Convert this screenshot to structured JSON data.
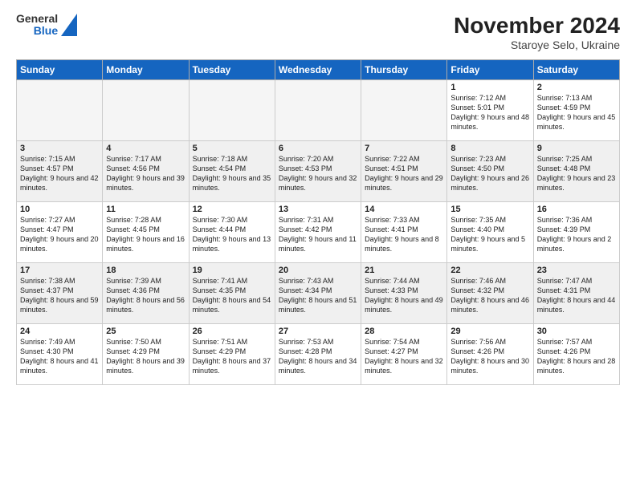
{
  "header": {
    "logo": {
      "general": "General",
      "blue": "Blue"
    },
    "title": "November 2024",
    "subtitle": "Staroye Selo, Ukraine"
  },
  "days_of_week": [
    "Sunday",
    "Monday",
    "Tuesday",
    "Wednesday",
    "Thursday",
    "Friday",
    "Saturday"
  ],
  "weeks": [
    [
      {
        "day": "",
        "empty": true
      },
      {
        "day": "",
        "empty": true
      },
      {
        "day": "",
        "empty": true
      },
      {
        "day": "",
        "empty": true
      },
      {
        "day": "",
        "empty": true
      },
      {
        "day": "1",
        "sunrise": "Sunrise: 7:12 AM",
        "sunset": "Sunset: 5:01 PM",
        "daylight": "Daylight: 9 hours and 48 minutes."
      },
      {
        "day": "2",
        "sunrise": "Sunrise: 7:13 AM",
        "sunset": "Sunset: 4:59 PM",
        "daylight": "Daylight: 9 hours and 45 minutes."
      }
    ],
    [
      {
        "day": "3",
        "sunrise": "Sunrise: 7:15 AM",
        "sunset": "Sunset: 4:57 PM",
        "daylight": "Daylight: 9 hours and 42 minutes."
      },
      {
        "day": "4",
        "sunrise": "Sunrise: 7:17 AM",
        "sunset": "Sunset: 4:56 PM",
        "daylight": "Daylight: 9 hours and 39 minutes."
      },
      {
        "day": "5",
        "sunrise": "Sunrise: 7:18 AM",
        "sunset": "Sunset: 4:54 PM",
        "daylight": "Daylight: 9 hours and 35 minutes."
      },
      {
        "day": "6",
        "sunrise": "Sunrise: 7:20 AM",
        "sunset": "Sunset: 4:53 PM",
        "daylight": "Daylight: 9 hours and 32 minutes."
      },
      {
        "day": "7",
        "sunrise": "Sunrise: 7:22 AM",
        "sunset": "Sunset: 4:51 PM",
        "daylight": "Daylight: 9 hours and 29 minutes."
      },
      {
        "day": "8",
        "sunrise": "Sunrise: 7:23 AM",
        "sunset": "Sunset: 4:50 PM",
        "daylight": "Daylight: 9 hours and 26 minutes."
      },
      {
        "day": "9",
        "sunrise": "Sunrise: 7:25 AM",
        "sunset": "Sunset: 4:48 PM",
        "daylight": "Daylight: 9 hours and 23 minutes."
      }
    ],
    [
      {
        "day": "10",
        "sunrise": "Sunrise: 7:27 AM",
        "sunset": "Sunset: 4:47 PM",
        "daylight": "Daylight: 9 hours and 20 minutes."
      },
      {
        "day": "11",
        "sunrise": "Sunrise: 7:28 AM",
        "sunset": "Sunset: 4:45 PM",
        "daylight": "Daylight: 9 hours and 16 minutes."
      },
      {
        "day": "12",
        "sunrise": "Sunrise: 7:30 AM",
        "sunset": "Sunset: 4:44 PM",
        "daylight": "Daylight: 9 hours and 13 minutes."
      },
      {
        "day": "13",
        "sunrise": "Sunrise: 7:31 AM",
        "sunset": "Sunset: 4:42 PM",
        "daylight": "Daylight: 9 hours and 11 minutes."
      },
      {
        "day": "14",
        "sunrise": "Sunrise: 7:33 AM",
        "sunset": "Sunset: 4:41 PM",
        "daylight": "Daylight: 9 hours and 8 minutes."
      },
      {
        "day": "15",
        "sunrise": "Sunrise: 7:35 AM",
        "sunset": "Sunset: 4:40 PM",
        "daylight": "Daylight: 9 hours and 5 minutes."
      },
      {
        "day": "16",
        "sunrise": "Sunrise: 7:36 AM",
        "sunset": "Sunset: 4:39 PM",
        "daylight": "Daylight: 9 hours and 2 minutes."
      }
    ],
    [
      {
        "day": "17",
        "sunrise": "Sunrise: 7:38 AM",
        "sunset": "Sunset: 4:37 PM",
        "daylight": "Daylight: 8 hours and 59 minutes."
      },
      {
        "day": "18",
        "sunrise": "Sunrise: 7:39 AM",
        "sunset": "Sunset: 4:36 PM",
        "daylight": "Daylight: 8 hours and 56 minutes."
      },
      {
        "day": "19",
        "sunrise": "Sunrise: 7:41 AM",
        "sunset": "Sunset: 4:35 PM",
        "daylight": "Daylight: 8 hours and 54 minutes."
      },
      {
        "day": "20",
        "sunrise": "Sunrise: 7:43 AM",
        "sunset": "Sunset: 4:34 PM",
        "daylight": "Daylight: 8 hours and 51 minutes."
      },
      {
        "day": "21",
        "sunrise": "Sunrise: 7:44 AM",
        "sunset": "Sunset: 4:33 PM",
        "daylight": "Daylight: 8 hours and 49 minutes."
      },
      {
        "day": "22",
        "sunrise": "Sunrise: 7:46 AM",
        "sunset": "Sunset: 4:32 PM",
        "daylight": "Daylight: 8 hours and 46 minutes."
      },
      {
        "day": "23",
        "sunrise": "Sunrise: 7:47 AM",
        "sunset": "Sunset: 4:31 PM",
        "daylight": "Daylight: 8 hours and 44 minutes."
      }
    ],
    [
      {
        "day": "24",
        "sunrise": "Sunrise: 7:49 AM",
        "sunset": "Sunset: 4:30 PM",
        "daylight": "Daylight: 8 hours and 41 minutes."
      },
      {
        "day": "25",
        "sunrise": "Sunrise: 7:50 AM",
        "sunset": "Sunset: 4:29 PM",
        "daylight": "Daylight: 8 hours and 39 minutes."
      },
      {
        "day": "26",
        "sunrise": "Sunrise: 7:51 AM",
        "sunset": "Sunset: 4:29 PM",
        "daylight": "Daylight: 8 hours and 37 minutes."
      },
      {
        "day": "27",
        "sunrise": "Sunrise: 7:53 AM",
        "sunset": "Sunset: 4:28 PM",
        "daylight": "Daylight: 8 hours and 34 minutes."
      },
      {
        "day": "28",
        "sunrise": "Sunrise: 7:54 AM",
        "sunset": "Sunset: 4:27 PM",
        "daylight": "Daylight: 8 hours and 32 minutes."
      },
      {
        "day": "29",
        "sunrise": "Sunrise: 7:56 AM",
        "sunset": "Sunset: 4:26 PM",
        "daylight": "Daylight: 8 hours and 30 minutes."
      },
      {
        "day": "30",
        "sunrise": "Sunrise: 7:57 AM",
        "sunset": "Sunset: 4:26 PM",
        "daylight": "Daylight: 8 hours and 28 minutes."
      }
    ]
  ]
}
